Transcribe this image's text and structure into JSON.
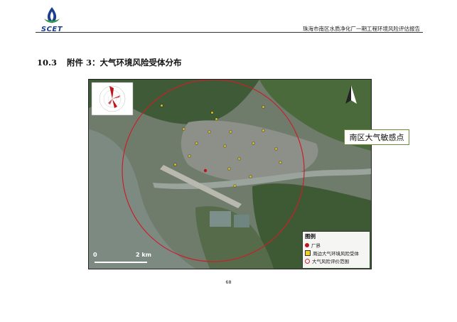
{
  "header": {
    "logo_text": "SCET",
    "report_title": "珠海市南区水质净化厂一期工程环境风险评估报告"
  },
  "section": {
    "number": "10.3",
    "title": "附件 3：大气环境风险受体分布"
  },
  "map": {
    "callout": "南区大气敏感点",
    "legend": {
      "title": "图例",
      "items": [
        {
          "label": "厂界",
          "color": "#c0141c"
        },
        {
          "label": "周边大气环境风险受体",
          "color": "#f2d21a"
        },
        {
          "label": "大气风险评价范围",
          "color": "#d0202a"
        }
      ]
    },
    "scalebar": {
      "start": "0",
      "end": "2 km"
    }
  },
  "footer": {
    "page_number": "68"
  },
  "colors": {
    "logo_blue": "#1b3f8f",
    "logo_green": "#2e9b46",
    "risk_circle": "#c8202a",
    "receptor_marker": "#f2d21a"
  }
}
